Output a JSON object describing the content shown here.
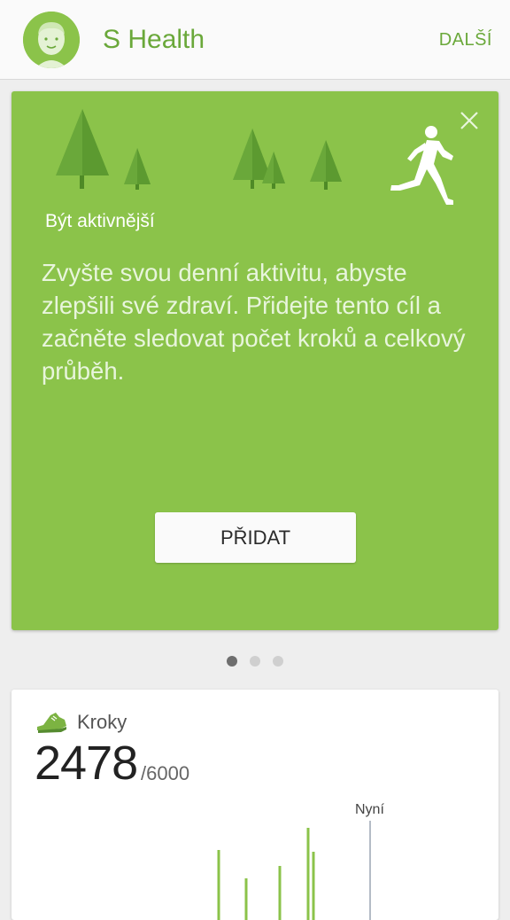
{
  "header": {
    "title": "S Health",
    "more_label": "DALŠÍ",
    "colors": {
      "accent": "#6aa83a",
      "avatar_bg": "#8bc34a"
    }
  },
  "goal_card": {
    "title": "Být aktivnější",
    "description": "Zvyšte svou denní aktivitu, abyste zlepšili své zdraví. Přidejte tento cíl a začněte sledovat počet kroků a celkový průběh.",
    "add_label": "PŘIDAT",
    "close_icon": "close-icon",
    "background_color": "#8bc34a"
  },
  "pager": {
    "count": 3,
    "active_index": 0
  },
  "steps_card": {
    "label": "Kroky",
    "count": "2478",
    "goal": "/6000",
    "now_label": "Nyní",
    "icon": "shoe-icon"
  }
}
